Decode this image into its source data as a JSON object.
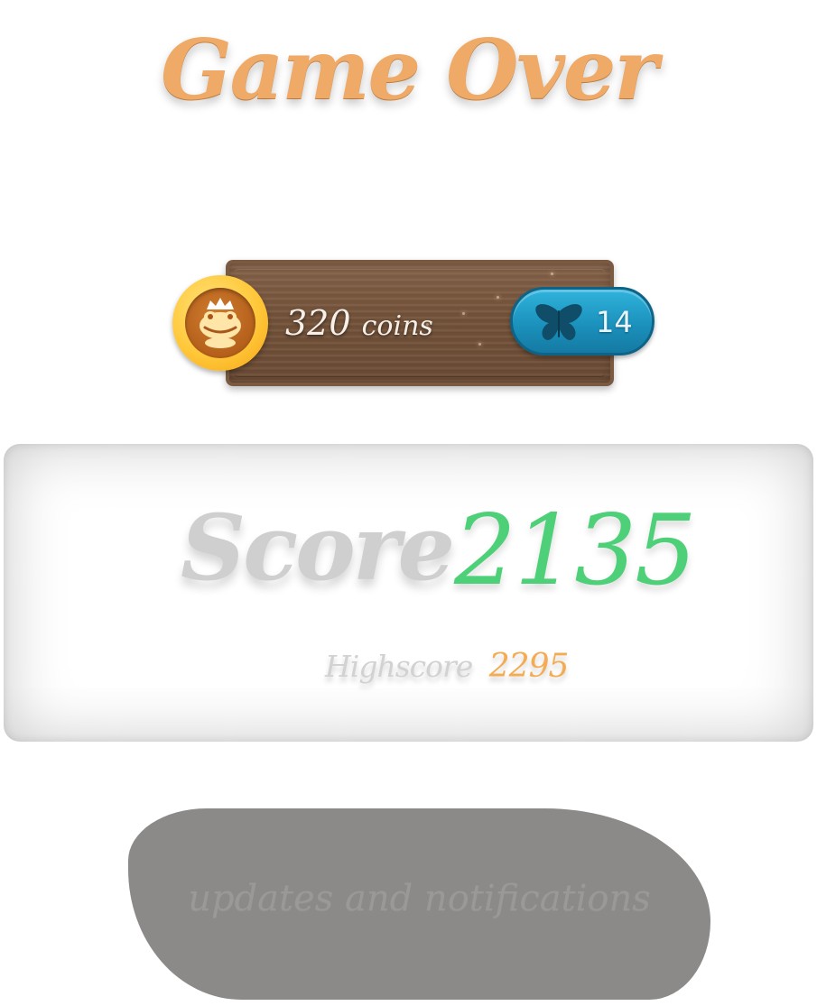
{
  "title": "Game Over",
  "currency": {
    "coins_value": "320",
    "coins_unit": "coins",
    "coin_icon": "frog-coin-icon",
    "butterfly_icon": "butterfly-icon",
    "butterflies": "14"
  },
  "score": {
    "label": "Score",
    "value": "2135",
    "highscore_label": "Highscore",
    "highscore_value": "2295"
  },
  "notification_button": {
    "label": "updates and notifications"
  },
  "colors": {
    "title": "#eeaa66",
    "score_value": "#4ed078",
    "highscore_value": "#f4ab52",
    "badge": "#1a8fba",
    "button": "#8b8a88"
  }
}
